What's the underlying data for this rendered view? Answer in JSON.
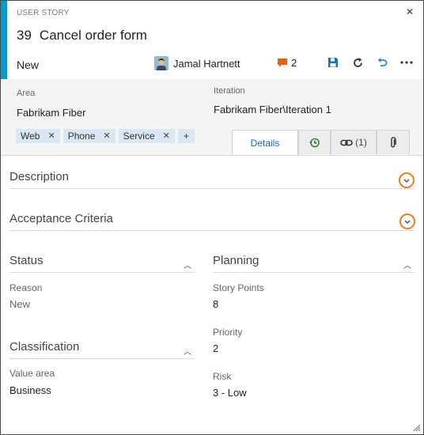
{
  "header": {
    "type_label": "USER STORY",
    "id": "39",
    "title": "Cancel order form",
    "state": "New",
    "assignee": "Jamal Hartnett",
    "comment_count": "2",
    "accent_color": "#009ccc",
    "icons": [
      "close-icon",
      "comment-icon",
      "save-icon",
      "refresh-icon",
      "undo-icon",
      "more-icon"
    ]
  },
  "info": {
    "area_label": "Area",
    "area_value": "Fabrikam Fiber",
    "iteration_label": "Iteration",
    "iteration_value": "Fabrikam Fiber\\Iteration 1",
    "tags": [
      "Web",
      "Phone",
      "Service"
    ],
    "add_tag": "+"
  },
  "tabs": {
    "details": "Details",
    "links_count": "(1)",
    "icons": [
      "history-icon",
      "link-icon",
      "attachment-icon"
    ]
  },
  "sections": {
    "description": "Description",
    "acceptance": "Acceptance Criteria",
    "status": "Status",
    "planning": "Planning",
    "classification": "Classification"
  },
  "fields": {
    "reason_label": "Reason",
    "reason_value": "New",
    "story_points_label": "Story Points",
    "story_points_value": "8",
    "priority_label": "Priority",
    "priority_value": "2",
    "value_area_label": "Value area",
    "value_area_value": "Business",
    "risk_label": "Risk",
    "risk_value": "3 - Low"
  },
  "colors": {
    "highlight_ring": "#f07d1d",
    "active_tab_text": "#106ebe",
    "tag_bg": "#d8e7f3",
    "comment_icon": "#e8630a"
  }
}
